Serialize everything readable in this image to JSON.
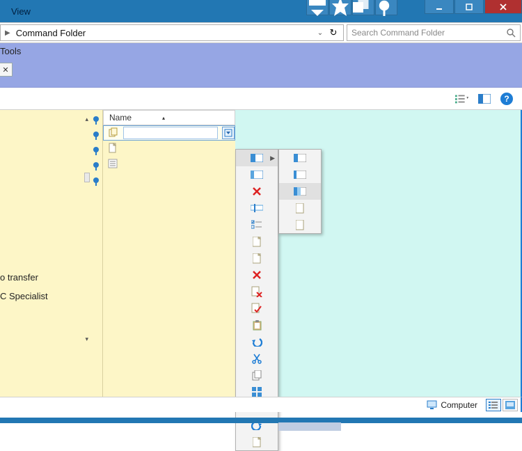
{
  "titlebar": {
    "view_label": "View"
  },
  "address": {
    "breadcrumb": "Command Folder",
    "search_placeholder": "Search Command Folder"
  },
  "ribbon": {
    "tools": "Tools"
  },
  "leftpanel": {
    "line1": "o transfer",
    "line2": "C Specialist"
  },
  "columns": {
    "name": "Name"
  },
  "status": {
    "computer": "Computer"
  }
}
